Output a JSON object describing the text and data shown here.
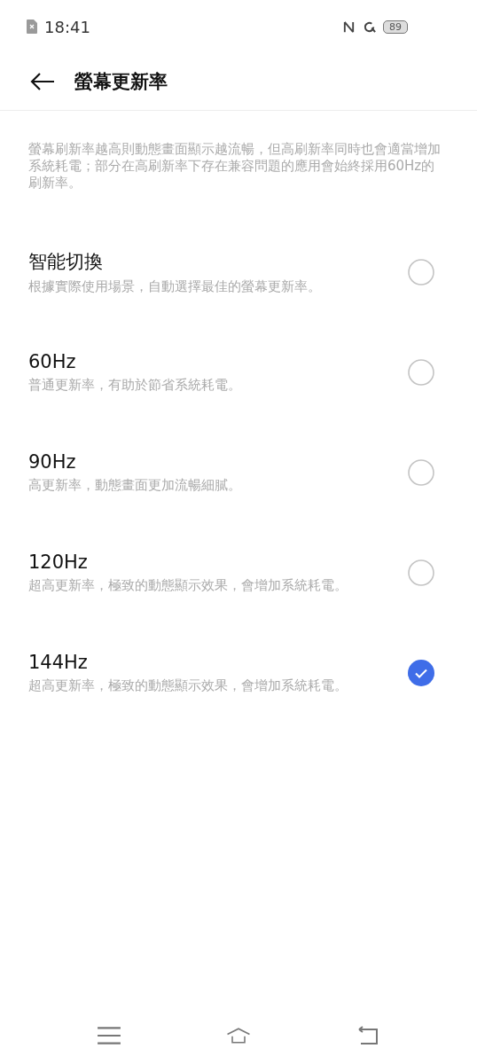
{
  "status_bar": {
    "time": "18:41",
    "battery": "89"
  },
  "header": {
    "title": "螢幕更新率"
  },
  "description": "螢幕刷新率越高則動態畫面顯示越流暢，但高刷新率同時也會適當增加系統耗電；部分在高刷新率下存在兼容問題的應用會始終採用60Hz的刷新率。",
  "options": [
    {
      "title": "智能切換",
      "subtitle": "根據實際使用場景，自動選擇最佳的螢幕更新率。",
      "selected": false
    },
    {
      "title": "60Hz",
      "subtitle": "普通更新率，有助於節省系統耗電。",
      "selected": false
    },
    {
      "title": "90Hz",
      "subtitle": "高更新率，動態畫面更加流暢細膩。",
      "selected": false
    },
    {
      "title": "120Hz",
      "subtitle": "超高更新率，極致的動態顯示效果，會增加系統耗電。",
      "selected": false
    },
    {
      "title": "144Hz",
      "subtitle": "超高更新率，極致的動態顯示效果，會增加系統耗電。",
      "selected": true
    }
  ]
}
